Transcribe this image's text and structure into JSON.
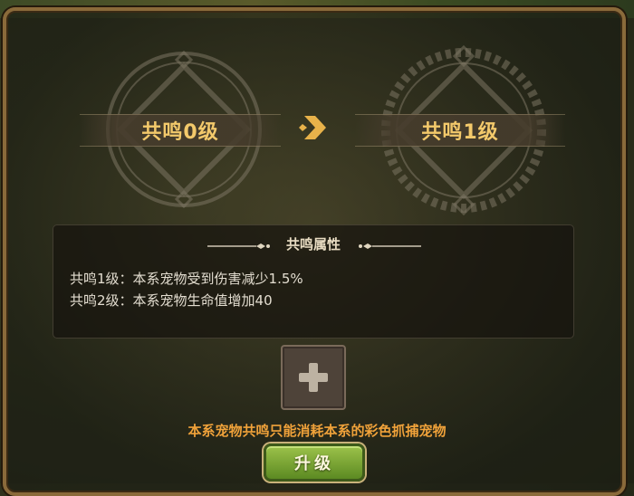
{
  "resonance": {
    "current_level_label": "共鸣0级",
    "next_level_label": "共鸣1级"
  },
  "attributes": {
    "title": "共鸣属性",
    "lines": [
      "共鸣1级：本系宠物受到伤害减少1.5%",
      "共鸣2级：本系宠物生命值增加40"
    ]
  },
  "add_slot": {
    "icon": "plus-icon"
  },
  "note": "本系宠物共鸣只能消耗本系的彩色抓捕宠物",
  "upgrade_button": "升级",
  "colors": {
    "accent_gold": "#f3c96b",
    "note_orange": "#f0a23a",
    "button_green": "#7aa83a"
  }
}
